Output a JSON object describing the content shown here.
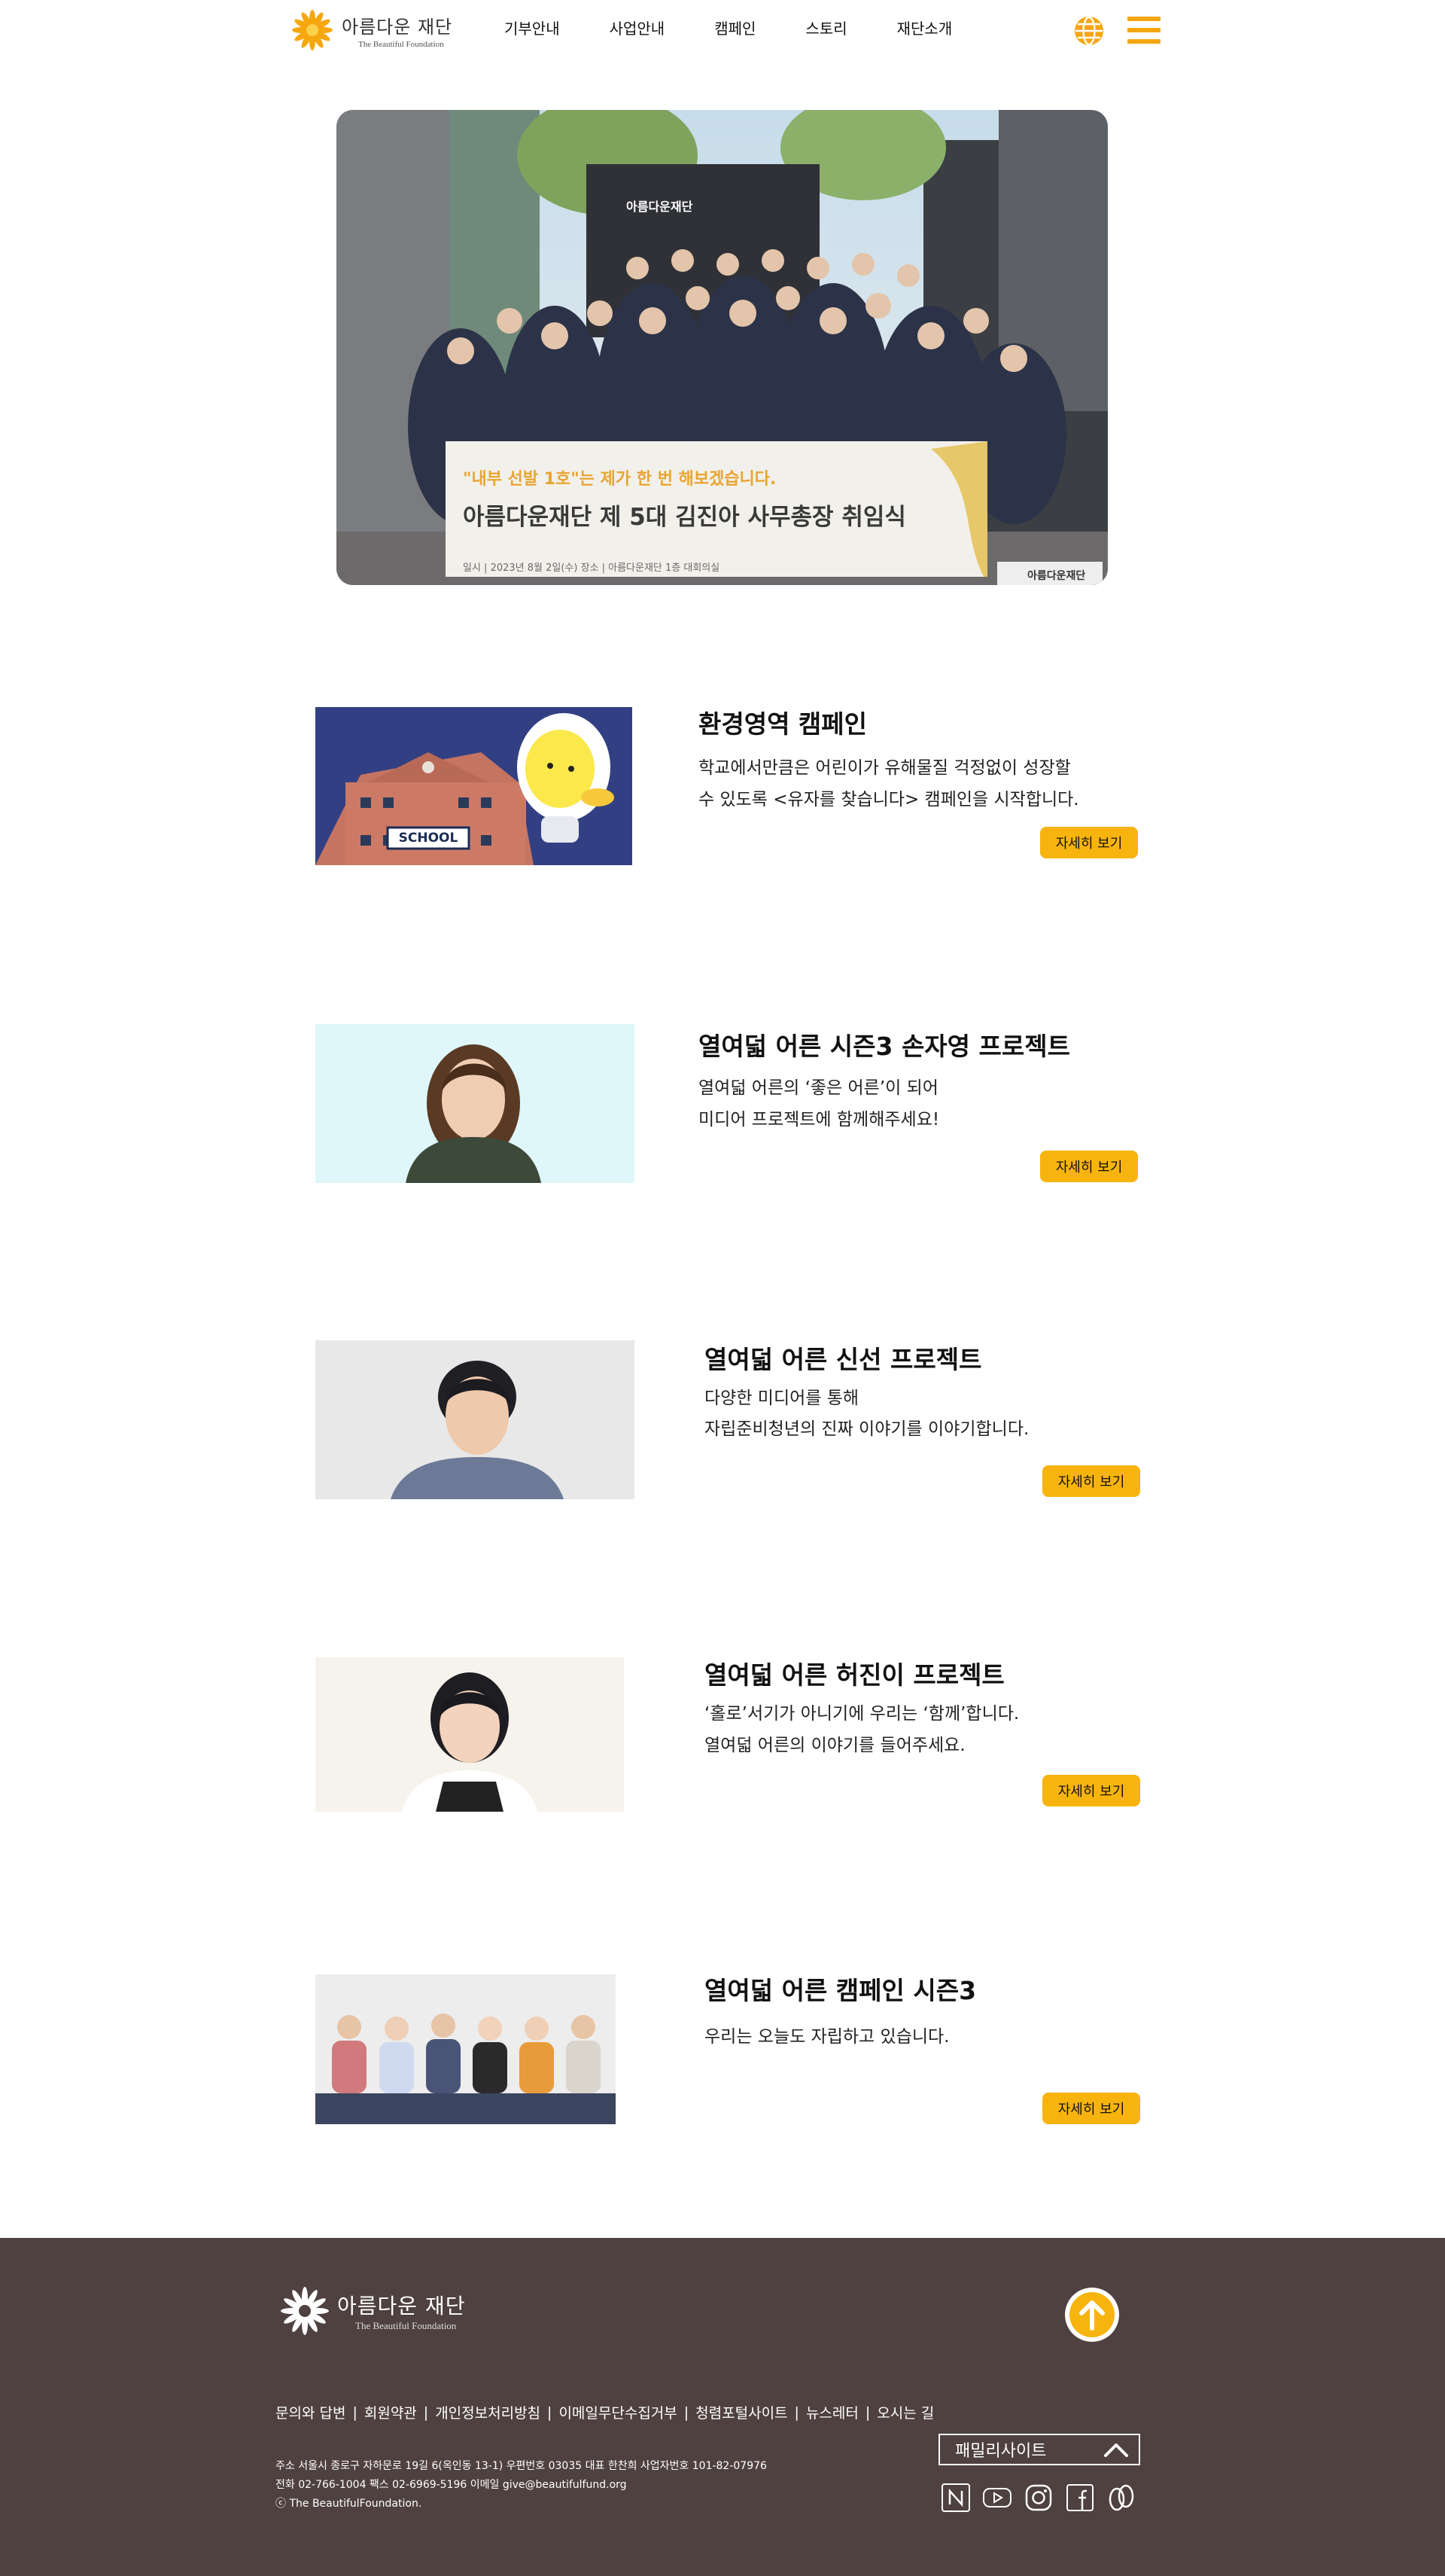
{
  "header": {
    "logo_ko": "아름다운 재단",
    "logo_en": "The Beautiful Foundation",
    "nav": [
      "기부안내",
      "사업안내",
      "캠페인",
      "스토리",
      "재단소개"
    ]
  },
  "hero": {
    "sign_text": "아름다운재단",
    "banner_line1": "\"내부 선발 1호\"는 제가 한 번 해보겠습니다.",
    "banner_line2": "아름다운재단 제 5대 김진아 사무총장 취임식",
    "banner_line3": "일시 | 2023년 8월 2일(수)   장소 | 아름다운재단 1층 대회의실",
    "watermark": "아름다운재단"
  },
  "items": [
    {
      "title": "환경영역 캠페인",
      "desc1": "학교에서만큼은 어린이가 유해물질 걱정없이 성장할",
      "desc2": "수 있도록 <유자를 찾습니다> 캠페인을 시작합니다.",
      "button": "자세히 보기",
      "school_sign": "SCHOOL"
    },
    {
      "title": "열여덟 어른 시즌3 손자영 프로젝트",
      "desc1": "열여덟 어른의 ‘좋은 어른’이 되어",
      "desc2": "미디어 프로젝트에 함께해주세요!",
      "button": "자세히 보기"
    },
    {
      "title": "열여덟 어른 신선 프로젝트",
      "desc1": "다양한 미디어를 통해",
      "desc2": "자립준비청년의 진짜 이야기를 이야기합니다.",
      "button": "자세히 보기"
    },
    {
      "title": "열여덟 어른 허진이 프로젝트",
      "desc1": "‘홀로’서기가 아니기에 우리는 ‘함께’합니다.",
      "desc2": "열여덟 어른의 이야기를 들어주세요.",
      "button": "자세히 보기"
    },
    {
      "title": "열여덟 어른 캠페인 시즌3",
      "desc1": "우리는 오늘도 자립하고 있습니다.",
      "desc2": "",
      "button": "자세히 보기"
    }
  ],
  "footer": {
    "logo_ko": "아름다운 재단",
    "logo_en": "The Beautiful Foundation",
    "links": [
      "문의와 답변",
      "회원약관",
      "개인정보처리방침",
      "이메일무단수집거부",
      "청렴포털사이트",
      "뉴스레터",
      "오시는 길"
    ],
    "address": "주소 서울시 종로구 자하문로 19길 6(옥인동 13-1) 우편번호 03035 대표 한찬희 사업자번호 101-82-07976",
    "contact": "전화 02-766-1004 팩스 02-6969-5196 이메일 give@beautifulfund.org",
    "copyright": "ⓒ The BeautifulFoundation.",
    "family_site": "패밀리사이트",
    "social_icons": [
      "naver-icon",
      "youtube-icon",
      "instagram-icon",
      "facebook-icon",
      "blog-icon"
    ]
  },
  "colors": {
    "accent": "#f8b40e",
    "footer_bg": "#4f4140"
  }
}
